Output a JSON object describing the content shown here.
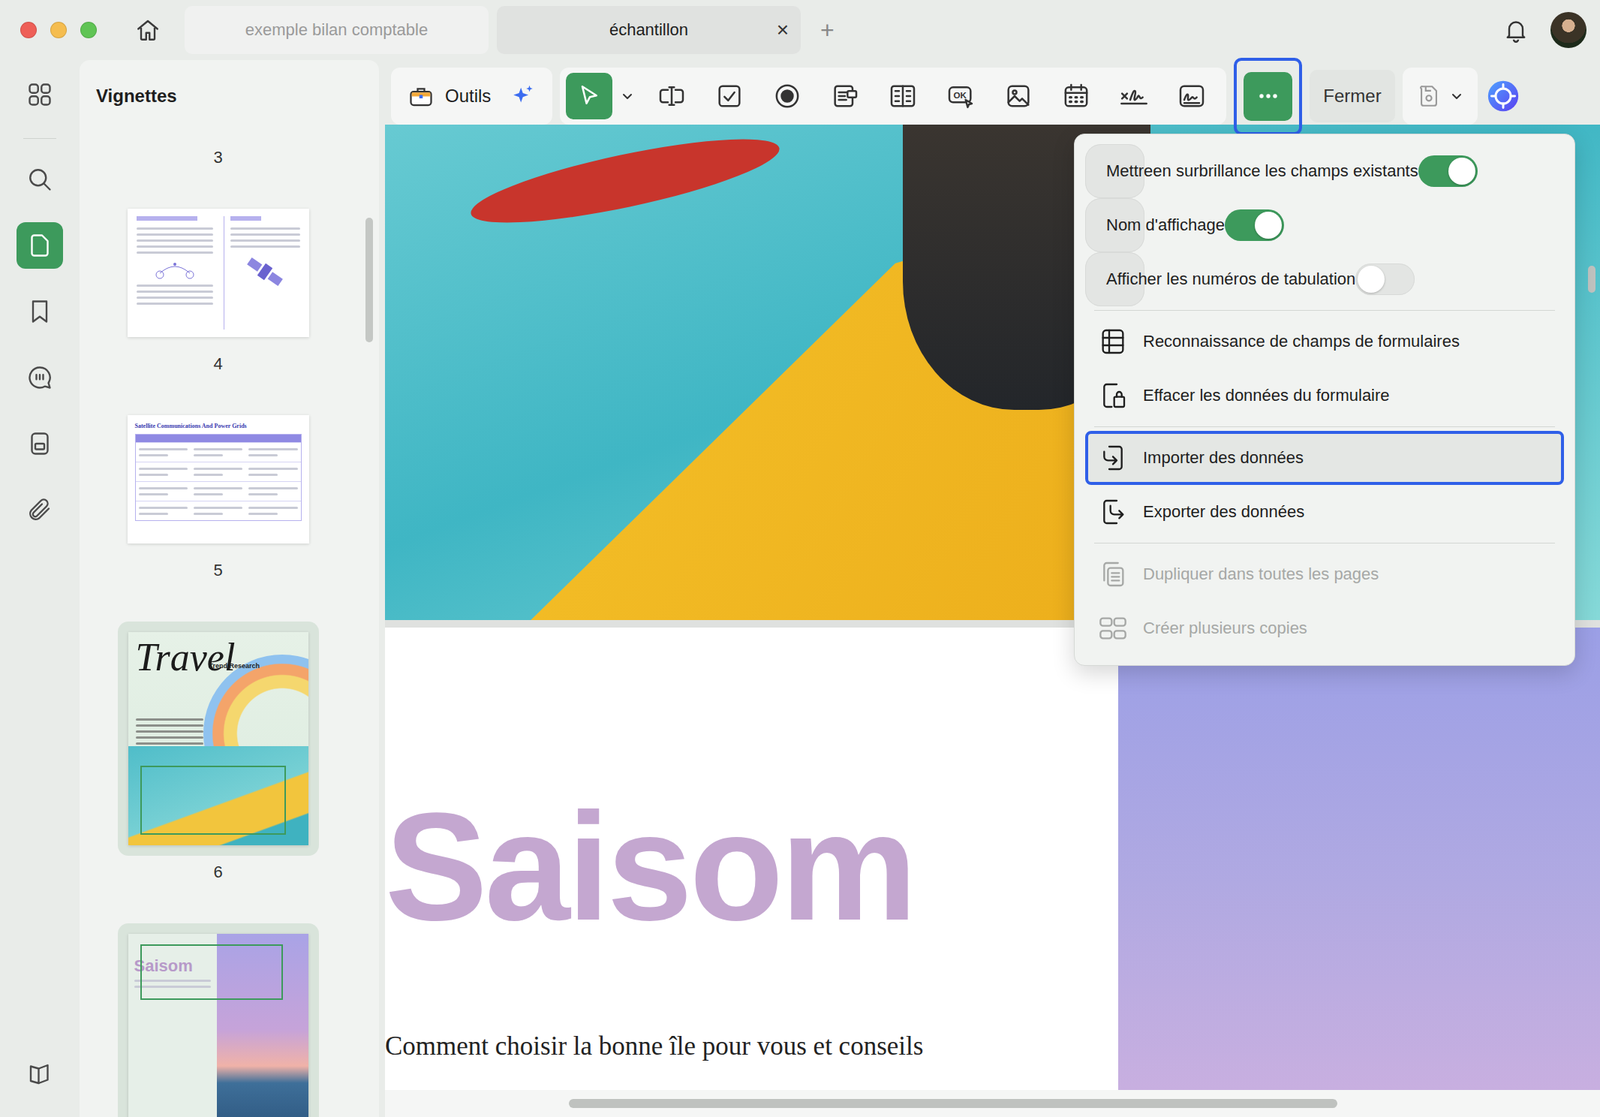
{
  "window": {
    "tabs": [
      {
        "label": "exemple bilan comptable",
        "selected": false,
        "closable": false
      },
      {
        "label": "échantillon",
        "selected": true,
        "closable": true
      }
    ],
    "close_glyph": "×",
    "new_tab_glyph": "+"
  },
  "rail": {
    "top": [
      {
        "selected": false
      },
      {
        "selected": false
      },
      {
        "selected": true
      },
      {
        "selected": false
      },
      {
        "selected": false
      },
      {
        "selected": false
      },
      {
        "selected": false
      }
    ],
    "bottom": [
      {
        "selected": false
      }
    ]
  },
  "thumbnails": {
    "title": "Vignettes",
    "pages": [
      {
        "number": "3",
        "kind": "label",
        "selected": false,
        "hovered": false,
        "field_box": false
      },
      {
        "number": "4",
        "kind": "diagram",
        "selected": false,
        "hovered": false,
        "field_box": false
      },
      {
        "number": "5",
        "kind": "table",
        "selected": false,
        "hovered": false,
        "field_box": false,
        "title": "Satellite Communications And Power Grids"
      },
      {
        "number": "6",
        "kind": "travel",
        "selected": true,
        "hovered": false,
        "field_box": true,
        "title": "Travel",
        "subtitle": "Trend Research",
        "author": "BESSIE COOPER"
      },
      {
        "kind": "cover",
        "selected": false,
        "hovered": true,
        "field_box": true,
        "title": "Saisom"
      }
    ]
  },
  "toolbar": {
    "tools_label": "Outils",
    "tools": [
      {
        "kind": "select",
        "selected": true
      },
      {
        "kind": "text-field",
        "selected": false
      },
      {
        "kind": "checkbox",
        "selected": false
      },
      {
        "kind": "radio",
        "selected": false
      },
      {
        "kind": "combo-box",
        "selected": false
      },
      {
        "kind": "list-box",
        "selected": false
      },
      {
        "kind": "button",
        "selected": false,
        "label": "OK"
      },
      {
        "kind": "image",
        "selected": false
      },
      {
        "kind": "date",
        "selected": false
      },
      {
        "kind": "signature",
        "selected": false
      },
      {
        "kind": "signature-field",
        "selected": false
      }
    ],
    "more": {
      "selected": true,
      "highlighted": true
    },
    "close_label": "Fermer"
  },
  "menu": {
    "groups": [
      [
        {
          "label": "Mettreen surbrillance les champs existants",
          "kind": "toggle",
          "on": true
        },
        {
          "label": "Nom d'affichage",
          "kind": "toggle",
          "on": true
        },
        {
          "label": "Afficher les numéros de tabulation",
          "kind": "toggle",
          "on": false
        }
      ],
      [
        {
          "label": "Reconnaissance de champs de formulaires",
          "kind": "action",
          "highlighted": false,
          "disabled": false
        },
        {
          "label": "Effacer les données du formulaire",
          "kind": "action",
          "highlighted": false,
          "disabled": false
        }
      ],
      [
        {
          "label": "Importer des données",
          "kind": "action",
          "highlighted": true,
          "disabled": false
        },
        {
          "label": "Exporter des données",
          "kind": "action",
          "highlighted": false,
          "disabled": false
        }
      ],
      [
        {
          "label": "Dupliquer dans toutes les pages",
          "kind": "action",
          "highlighted": false,
          "disabled": true
        },
        {
          "label": "Créer plusieurs copies",
          "kind": "action",
          "highlighted": false,
          "disabled": true
        }
      ]
    ]
  },
  "document": {
    "heading": "Saisom",
    "subtitle": "Comment choisir la bonne île pour vous et conseils"
  }
}
